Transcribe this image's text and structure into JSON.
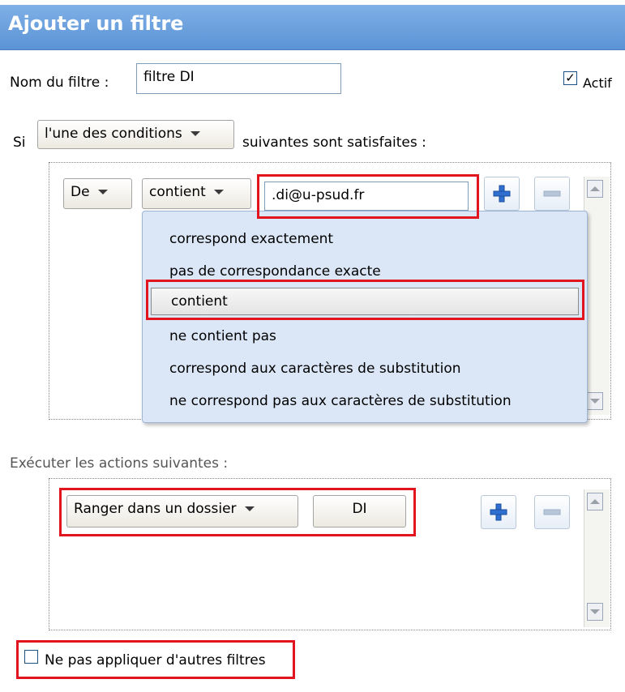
{
  "header": {
    "title": "Ajouter un filtre"
  },
  "filter": {
    "name_label": "Nom du filtre :",
    "name_value": "filtre DI",
    "active_label": "Actif",
    "active_checked": "✓"
  },
  "condition_line": {
    "prefix": "Si",
    "match_select": "l'une des conditions",
    "suffix": "suivantes sont satisfaites :"
  },
  "condition_row": {
    "field_select": "De",
    "operator_select": "contient",
    "value": ".di@u-psud.fr"
  },
  "operator_dropdown": {
    "items": [
      "correspond exactement",
      "pas de correspondance exacte",
      "contient",
      "ne contient pas",
      "correspond aux caractères de substitution",
      "ne correspond pas aux caractères de substitution"
    ],
    "selected": "contient"
  },
  "actions": {
    "title": "Exécuter les actions suivantes :",
    "action_select": "Ranger dans un dossier",
    "folder_button": "DI"
  },
  "stop_rules": {
    "label": "Ne pas appliquer d'autres filtres",
    "checked": ""
  },
  "colors": {
    "header_bg": "#6fa3e0",
    "highlight_red": "#e2141d",
    "dropdown_bg": "#dbe7f7",
    "plus_icon": "#2f6fd0",
    "minus_icon": "#b7c6d9"
  },
  "icons": {
    "add": "plus-icon",
    "remove": "minus-icon",
    "scroll_up": "scroll-up-arrow-icon",
    "scroll_down": "scroll-down-arrow-icon",
    "dropdown_arrow": "chevron-down-icon"
  }
}
